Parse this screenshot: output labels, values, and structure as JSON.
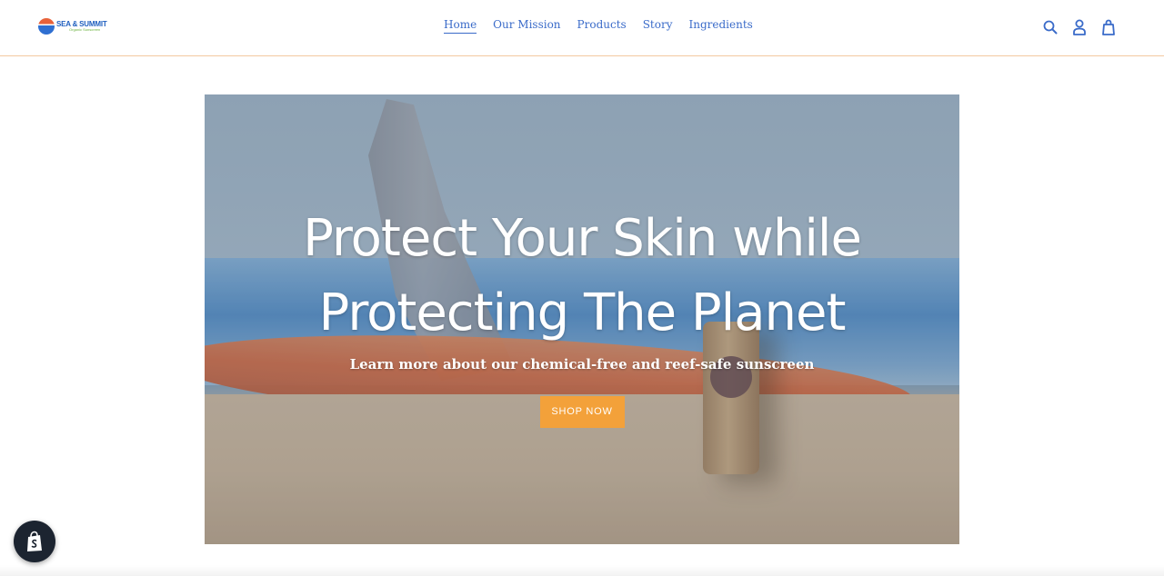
{
  "brand": {
    "name": "SEA & SUMMIT",
    "tagline": "Organic Sunscreen"
  },
  "nav": {
    "items": [
      {
        "label": "Home",
        "active": true
      },
      {
        "label": "Our Mission",
        "active": false
      },
      {
        "label": "Products",
        "active": false
      },
      {
        "label": "Story",
        "active": false
      },
      {
        "label": "Ingredients",
        "active": false
      }
    ]
  },
  "header_icons": [
    "search-icon",
    "account-icon",
    "cart-icon"
  ],
  "hero": {
    "title": "Protect Your Skin while Protecting The Planet",
    "subtitle": "Learn more about our chemical-free and reef-safe sunscreen",
    "cta_label": "SHOP NOW"
  },
  "colors": {
    "nav_link": "#3a6bc9",
    "cta": "#f3a13a",
    "header_border": "#f3c9a0"
  }
}
